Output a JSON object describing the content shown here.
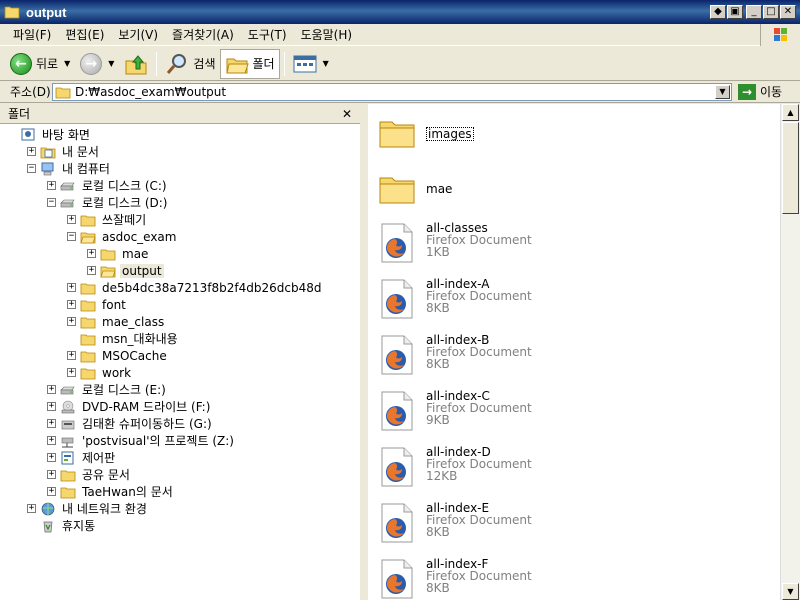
{
  "window": {
    "title": "output"
  },
  "menu": [
    "파일(F)",
    "편집(E)",
    "보기(V)",
    "즐겨찾기(A)",
    "도구(T)",
    "도움말(H)"
  ],
  "toolbar": {
    "back_label": "뒤로",
    "search_label": "검색",
    "folders_label": "폴더"
  },
  "address": {
    "label": "주소(D)",
    "value": "D:₩asdoc_exam₩output",
    "go_label": "이동"
  },
  "folder_pane": {
    "header": "폴더",
    "tree": [
      {
        "label": "바탕 화면",
        "icon": "desktop-icon",
        "depth": 0,
        "expander": ""
      },
      {
        "label": "내 문서",
        "icon": "my-documents-icon",
        "depth": 1,
        "expander": "+"
      },
      {
        "label": "내 컴퓨터",
        "icon": "my-computer-icon",
        "depth": 1,
        "expander": "-"
      },
      {
        "label": "로컬 디스크 (C:)",
        "icon": "hard-drive-icon",
        "depth": 2,
        "expander": "+"
      },
      {
        "label": "로컬 디스크 (D:)",
        "icon": "hard-drive-icon",
        "depth": 2,
        "expander": "-"
      },
      {
        "label": "쓰잘떼기",
        "icon": "folder-icon",
        "depth": 3,
        "expander": "+"
      },
      {
        "label": "asdoc_exam",
        "icon": "folder-open-icon",
        "depth": 3,
        "expander": "-"
      },
      {
        "label": "mae",
        "icon": "folder-icon",
        "depth": 4,
        "expander": "+"
      },
      {
        "label": "output",
        "icon": "folder-open-icon",
        "depth": 4,
        "expander": "+",
        "selected": true
      },
      {
        "label": "de5b4dc38a7213f8b2f4db26dcb48d",
        "icon": "folder-icon",
        "depth": 3,
        "expander": "+"
      },
      {
        "label": "font",
        "icon": "folder-icon",
        "depth": 3,
        "expander": "+"
      },
      {
        "label": "mae_class",
        "icon": "folder-icon",
        "depth": 3,
        "expander": "+"
      },
      {
        "label": "msn_대화내용",
        "icon": "folder-icon",
        "depth": 3,
        "expander": ""
      },
      {
        "label": "MSOCache",
        "icon": "folder-icon",
        "depth": 3,
        "expander": "+"
      },
      {
        "label": "work",
        "icon": "folder-icon",
        "depth": 3,
        "expander": "+"
      },
      {
        "label": "로컬 디스크 (E:)",
        "icon": "hard-drive-icon",
        "depth": 2,
        "expander": "+"
      },
      {
        "label": "DVD-RAM 드라이브 (F:)",
        "icon": "dvd-drive-icon",
        "depth": 2,
        "expander": "+"
      },
      {
        "label": "김태환 슈퍼이동하드 (G:)",
        "icon": "removable-drive-icon",
        "depth": 2,
        "expander": "+"
      },
      {
        "label": "'postvisual'의 프로젝트 (Z:)",
        "icon": "network-drive-icon",
        "depth": 2,
        "expander": "+"
      },
      {
        "label": "제어판",
        "icon": "control-panel-icon",
        "depth": 2,
        "expander": "+"
      },
      {
        "label": "공유 문서",
        "icon": "folder-icon",
        "depth": 2,
        "expander": "+"
      },
      {
        "label": "TaeHwan의 문서",
        "icon": "folder-icon",
        "depth": 2,
        "expander": "+"
      },
      {
        "label": "내 네트워크 환경",
        "icon": "network-places-icon",
        "depth": 1,
        "expander": "+"
      },
      {
        "label": "휴지통",
        "icon": "recycle-bin-icon",
        "depth": 1,
        "expander": ""
      }
    ]
  },
  "files": [
    {
      "name": "images",
      "kind": "folder"
    },
    {
      "name": "mae",
      "kind": "folder"
    },
    {
      "name": "all-classes",
      "type": "Firefox Document",
      "size": "1KB",
      "kind": "doc"
    },
    {
      "name": "all-index-A",
      "type": "Firefox Document",
      "size": "8KB",
      "kind": "doc"
    },
    {
      "name": "all-index-B",
      "type": "Firefox Document",
      "size": "8KB",
      "kind": "doc"
    },
    {
      "name": "all-index-C",
      "type": "Firefox Document",
      "size": "9KB",
      "kind": "doc"
    },
    {
      "name": "all-index-D",
      "type": "Firefox Document",
      "size": "12KB",
      "kind": "doc"
    },
    {
      "name": "all-index-E",
      "type": "Firefox Document",
      "size": "8KB",
      "kind": "doc"
    },
    {
      "name": "all-index-F",
      "type": "Firefox Document",
      "size": "8KB",
      "kind": "doc"
    }
  ]
}
